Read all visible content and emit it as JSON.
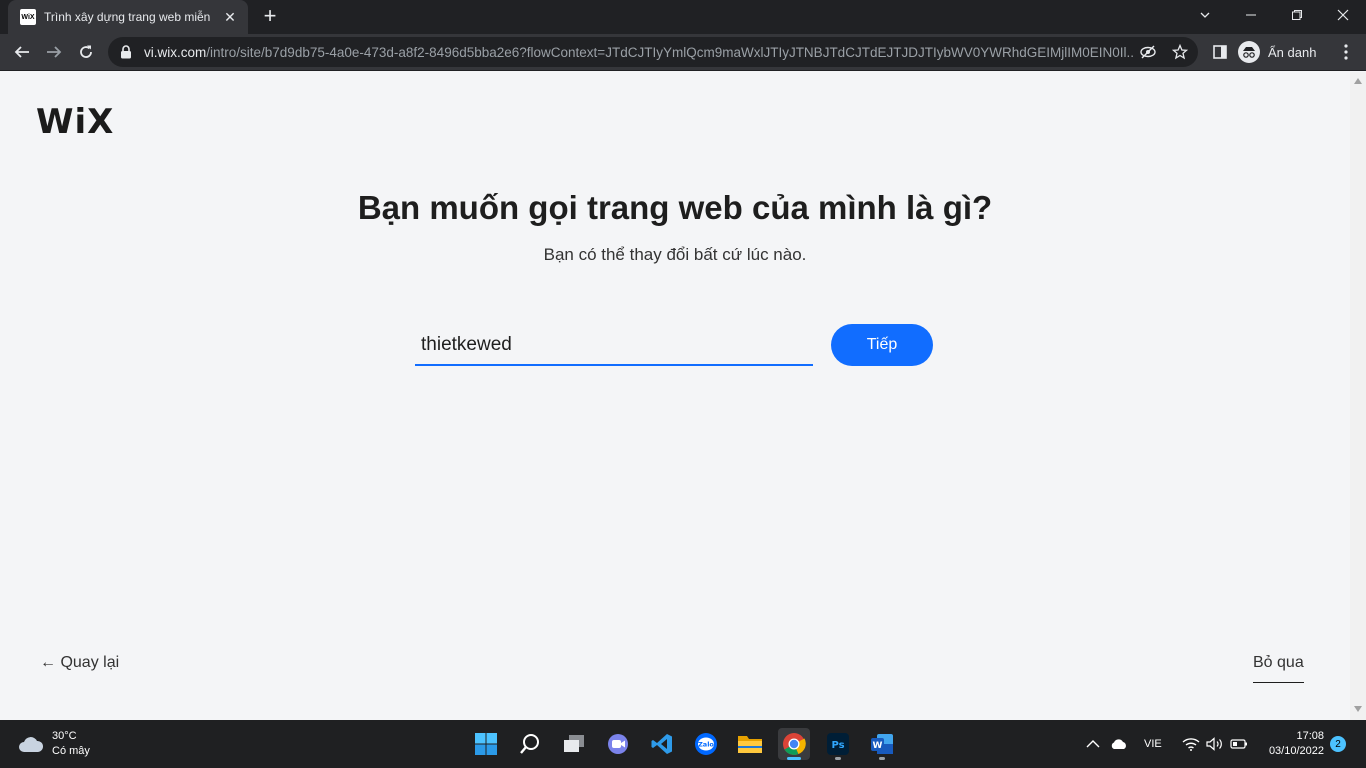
{
  "browser": {
    "tab_title": "Trình xây dựng trang web miễn phí",
    "tab_favicon_text": "WiX",
    "url_host": "vi.wix.com",
    "url_path": "/intro/site/b7d9db75-4a0e-473d-a8f2-8496d5bba2e6?flowContext=JTdCJTIyYmlQcm9maWxlJTIyJTNBJTdCJTdEJTJDJTIybWV0YWRhdGEIMjlIM0EIN0Il...",
    "incognito_label": "Ẩn danh"
  },
  "page": {
    "logo": "WiX",
    "heading": "Bạn muốn gọi trang web của mình là gì?",
    "subheading": "Bạn có thể thay đổi bất cứ lúc nào.",
    "site_name_value": "thietkewed",
    "next_label": "Tiếp",
    "back_label": "← Quay lại",
    "skip_label": "Bỏ qua",
    "accent_color": "#116dff"
  },
  "taskbar": {
    "weather_temp": "30°C",
    "weather_desc": "Có mây",
    "apps": [
      "start-icon",
      "search-icon",
      "task-view-icon",
      "teams-icon",
      "vscode-icon",
      "zalo-icon",
      "file-explorer-icon",
      "chrome-icon",
      "photoshop-icon",
      "word-icon"
    ],
    "zalo_label": "Zalo",
    "ps_label": "Ps",
    "word_label": "W",
    "language": "VIE",
    "time": "17:08",
    "date": "03/10/2022",
    "notification_count": "2"
  }
}
